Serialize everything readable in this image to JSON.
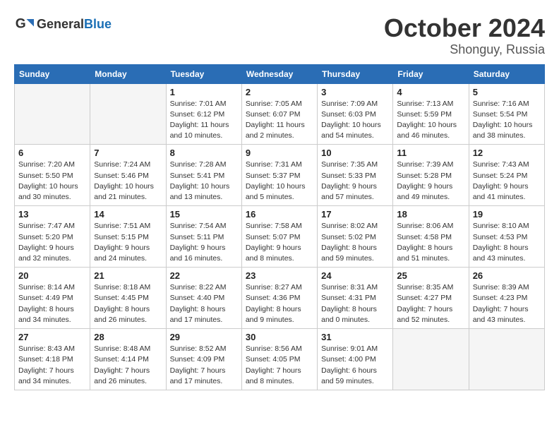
{
  "logo": {
    "general": "General",
    "blue": "Blue"
  },
  "header": {
    "month": "October 2024",
    "location": "Shonguy, Russia"
  },
  "days_of_week": [
    "Sunday",
    "Monday",
    "Tuesday",
    "Wednesday",
    "Thursday",
    "Friday",
    "Saturday"
  ],
  "weeks": [
    [
      {
        "day": "",
        "info": ""
      },
      {
        "day": "",
        "info": ""
      },
      {
        "day": "1",
        "info": "Sunrise: 7:01 AM\nSunset: 6:12 PM\nDaylight: 11 hours\nand 10 minutes."
      },
      {
        "day": "2",
        "info": "Sunrise: 7:05 AM\nSunset: 6:07 PM\nDaylight: 11 hours\nand 2 minutes."
      },
      {
        "day": "3",
        "info": "Sunrise: 7:09 AM\nSunset: 6:03 PM\nDaylight: 10 hours\nand 54 minutes."
      },
      {
        "day": "4",
        "info": "Sunrise: 7:13 AM\nSunset: 5:59 PM\nDaylight: 10 hours\nand 46 minutes."
      },
      {
        "day": "5",
        "info": "Sunrise: 7:16 AM\nSunset: 5:54 PM\nDaylight: 10 hours\nand 38 minutes."
      }
    ],
    [
      {
        "day": "6",
        "info": "Sunrise: 7:20 AM\nSunset: 5:50 PM\nDaylight: 10 hours\nand 30 minutes."
      },
      {
        "day": "7",
        "info": "Sunrise: 7:24 AM\nSunset: 5:46 PM\nDaylight: 10 hours\nand 21 minutes."
      },
      {
        "day": "8",
        "info": "Sunrise: 7:28 AM\nSunset: 5:41 PM\nDaylight: 10 hours\nand 13 minutes."
      },
      {
        "day": "9",
        "info": "Sunrise: 7:31 AM\nSunset: 5:37 PM\nDaylight: 10 hours\nand 5 minutes."
      },
      {
        "day": "10",
        "info": "Sunrise: 7:35 AM\nSunset: 5:33 PM\nDaylight: 9 hours\nand 57 minutes."
      },
      {
        "day": "11",
        "info": "Sunrise: 7:39 AM\nSunset: 5:28 PM\nDaylight: 9 hours\nand 49 minutes."
      },
      {
        "day": "12",
        "info": "Sunrise: 7:43 AM\nSunset: 5:24 PM\nDaylight: 9 hours\nand 41 minutes."
      }
    ],
    [
      {
        "day": "13",
        "info": "Sunrise: 7:47 AM\nSunset: 5:20 PM\nDaylight: 9 hours\nand 32 minutes."
      },
      {
        "day": "14",
        "info": "Sunrise: 7:51 AM\nSunset: 5:15 PM\nDaylight: 9 hours\nand 24 minutes."
      },
      {
        "day": "15",
        "info": "Sunrise: 7:54 AM\nSunset: 5:11 PM\nDaylight: 9 hours\nand 16 minutes."
      },
      {
        "day": "16",
        "info": "Sunrise: 7:58 AM\nSunset: 5:07 PM\nDaylight: 9 hours\nand 8 minutes."
      },
      {
        "day": "17",
        "info": "Sunrise: 8:02 AM\nSunset: 5:02 PM\nDaylight: 8 hours\nand 59 minutes."
      },
      {
        "day": "18",
        "info": "Sunrise: 8:06 AM\nSunset: 4:58 PM\nDaylight: 8 hours\nand 51 minutes."
      },
      {
        "day": "19",
        "info": "Sunrise: 8:10 AM\nSunset: 4:53 PM\nDaylight: 8 hours\nand 43 minutes."
      }
    ],
    [
      {
        "day": "20",
        "info": "Sunrise: 8:14 AM\nSunset: 4:49 PM\nDaylight: 8 hours\nand 34 minutes."
      },
      {
        "day": "21",
        "info": "Sunrise: 8:18 AM\nSunset: 4:45 PM\nDaylight: 8 hours\nand 26 minutes."
      },
      {
        "day": "22",
        "info": "Sunrise: 8:22 AM\nSunset: 4:40 PM\nDaylight: 8 hours\nand 17 minutes."
      },
      {
        "day": "23",
        "info": "Sunrise: 8:27 AM\nSunset: 4:36 PM\nDaylight: 8 hours\nand 9 minutes."
      },
      {
        "day": "24",
        "info": "Sunrise: 8:31 AM\nSunset: 4:31 PM\nDaylight: 8 hours\nand 0 minutes."
      },
      {
        "day": "25",
        "info": "Sunrise: 8:35 AM\nSunset: 4:27 PM\nDaylight: 7 hours\nand 52 minutes."
      },
      {
        "day": "26",
        "info": "Sunrise: 8:39 AM\nSunset: 4:23 PM\nDaylight: 7 hours\nand 43 minutes."
      }
    ],
    [
      {
        "day": "27",
        "info": "Sunrise: 8:43 AM\nSunset: 4:18 PM\nDaylight: 7 hours\nand 34 minutes."
      },
      {
        "day": "28",
        "info": "Sunrise: 8:48 AM\nSunset: 4:14 PM\nDaylight: 7 hours\nand 26 minutes."
      },
      {
        "day": "29",
        "info": "Sunrise: 8:52 AM\nSunset: 4:09 PM\nDaylight: 7 hours\nand 17 minutes."
      },
      {
        "day": "30",
        "info": "Sunrise: 8:56 AM\nSunset: 4:05 PM\nDaylight: 7 hours\nand 8 minutes."
      },
      {
        "day": "31",
        "info": "Sunrise: 9:01 AM\nSunset: 4:00 PM\nDaylight: 6 hours\nand 59 minutes."
      },
      {
        "day": "",
        "info": ""
      },
      {
        "day": "",
        "info": ""
      }
    ]
  ]
}
